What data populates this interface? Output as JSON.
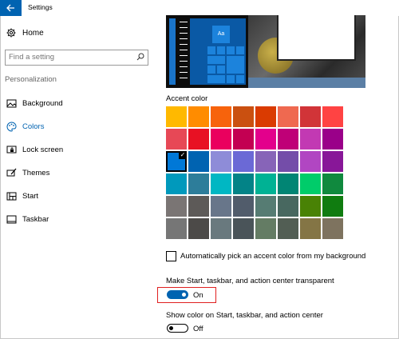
{
  "window": {
    "title": "Settings"
  },
  "sidebar": {
    "home_label": "Home",
    "search": {
      "placeholder": "Find a setting",
      "value": "Find a setting"
    },
    "section_title": "Personalization",
    "items": [
      {
        "label": "Background",
        "icon": "picture-icon"
      },
      {
        "label": "Colors",
        "icon": "palette-icon",
        "active": true
      },
      {
        "label": "Lock screen",
        "icon": "lock-screen-icon"
      },
      {
        "label": "Themes",
        "icon": "brush-icon"
      },
      {
        "label": "Start",
        "icon": "start-grid-icon"
      },
      {
        "label": "Taskbar",
        "icon": "taskbar-icon"
      }
    ]
  },
  "main": {
    "preview": {
      "tile_label": "Aa"
    },
    "accent_title": "Accent color",
    "accent_colors": [
      [
        "#ffb900",
        "#ff8c00",
        "#f7630c",
        "#ca5010",
        "#da3b01",
        "#ef6950",
        "#d13438",
        "#ff4343"
      ],
      [
        "#e74856",
        "#e81123",
        "#ea005e",
        "#c30052",
        "#e3008c",
        "#bf0077",
        "#c239b3",
        "#9a0089"
      ],
      [
        "#0078d7",
        "#0063b1",
        "#8e8cd8",
        "#6b69d6",
        "#8764b8",
        "#744da9",
        "#b146c2",
        "#881798"
      ],
      [
        "#0099bc",
        "#2d7d9a",
        "#00b7c3",
        "#038387",
        "#00b294",
        "#018574",
        "#00cc6a",
        "#10893e"
      ],
      [
        "#7a7574",
        "#5d5a58",
        "#68768a",
        "#515c6b",
        "#567c73",
        "#486860",
        "#498205",
        "#107c10"
      ],
      [
        "#767676",
        "#4c4a48",
        "#69797e",
        "#4a5459",
        "#647c64",
        "#525e54",
        "#847545",
        "#7e735f"
      ]
    ],
    "selected_accent": "#0078d7",
    "auto_pick_label": "Automatically pick an accent color from my background",
    "auto_pick_checked": false,
    "transparent": {
      "title": "Make Start, taskbar, and action center transparent",
      "state_label": "On",
      "on": true
    },
    "show_color": {
      "title": "Show color on Start, taskbar, and action center",
      "state_label": "Off",
      "on": false
    },
    "highlight_color": "#e02020"
  }
}
